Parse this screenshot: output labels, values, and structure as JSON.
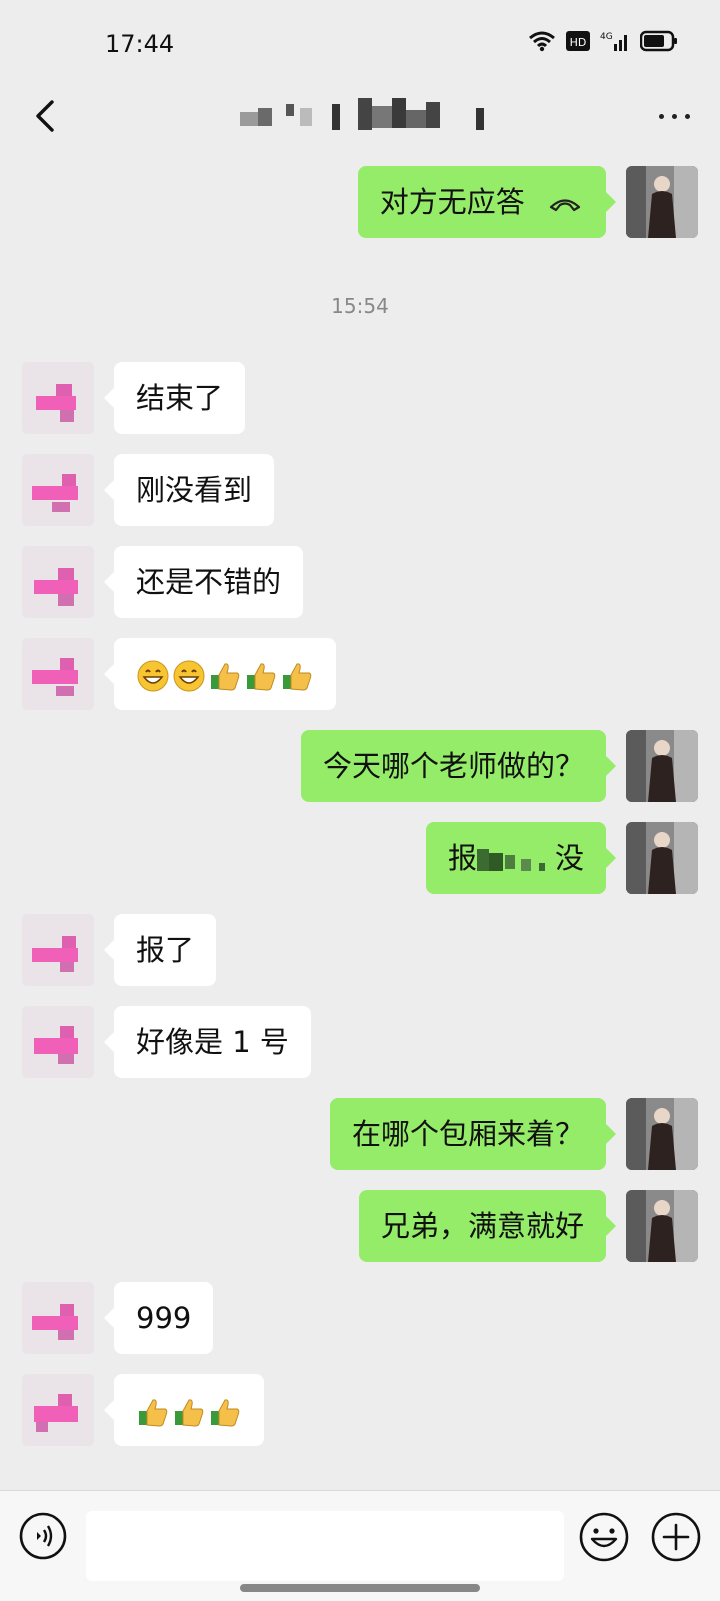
{
  "status_bar": {
    "time": "17:44",
    "icons": [
      "wifi-icon",
      "hd-icon",
      "signal-4g-icon",
      "battery-icon"
    ],
    "hd_label": "HD",
    "network_label": "4G"
  },
  "nav": {
    "title": "",
    "back_icon": "chevron-left-icon",
    "more_icon": "more-dots-icon"
  },
  "messages": [
    {
      "side": "right",
      "text": "对方无应答",
      "icon": "phone-hangup-icon"
    },
    {
      "type": "timestamp",
      "text": "15:54"
    },
    {
      "side": "left",
      "text": "结束了"
    },
    {
      "side": "left",
      "text": "刚没看到"
    },
    {
      "side": "left",
      "text": "还是不错的"
    },
    {
      "side": "left",
      "emojis": [
        "grin-emoji",
        "grin-emoji",
        "thumbs-up-emoji",
        "thumbs-up-emoji",
        "thumbs-up-emoji"
      ]
    },
    {
      "side": "right",
      "text": "今天哪个老师做的？"
    },
    {
      "side": "right",
      "text_start": "报",
      "text_end": "没"
    },
    {
      "side": "left",
      "text": "报了"
    },
    {
      "side": "left",
      "text": "好像是 1 号"
    },
    {
      "side": "right",
      "text": "在哪个包厢来着？"
    },
    {
      "side": "right",
      "text": "兄弟，满意就好"
    },
    {
      "side": "left",
      "text": "999"
    },
    {
      "side": "left",
      "emojis": [
        "thumbs-up-emoji",
        "thumbs-up-emoji",
        "thumbs-up-emoji"
      ]
    }
  ],
  "input_bar": {
    "voice_icon": "voice-icon",
    "emoji_icon": "emoji-face-icon",
    "plus_icon": "plus-circle-icon",
    "input_value": ""
  },
  "colors": {
    "background": "#ededed",
    "bubble_self": "#95ec69",
    "bubble_other": "#ffffff"
  }
}
